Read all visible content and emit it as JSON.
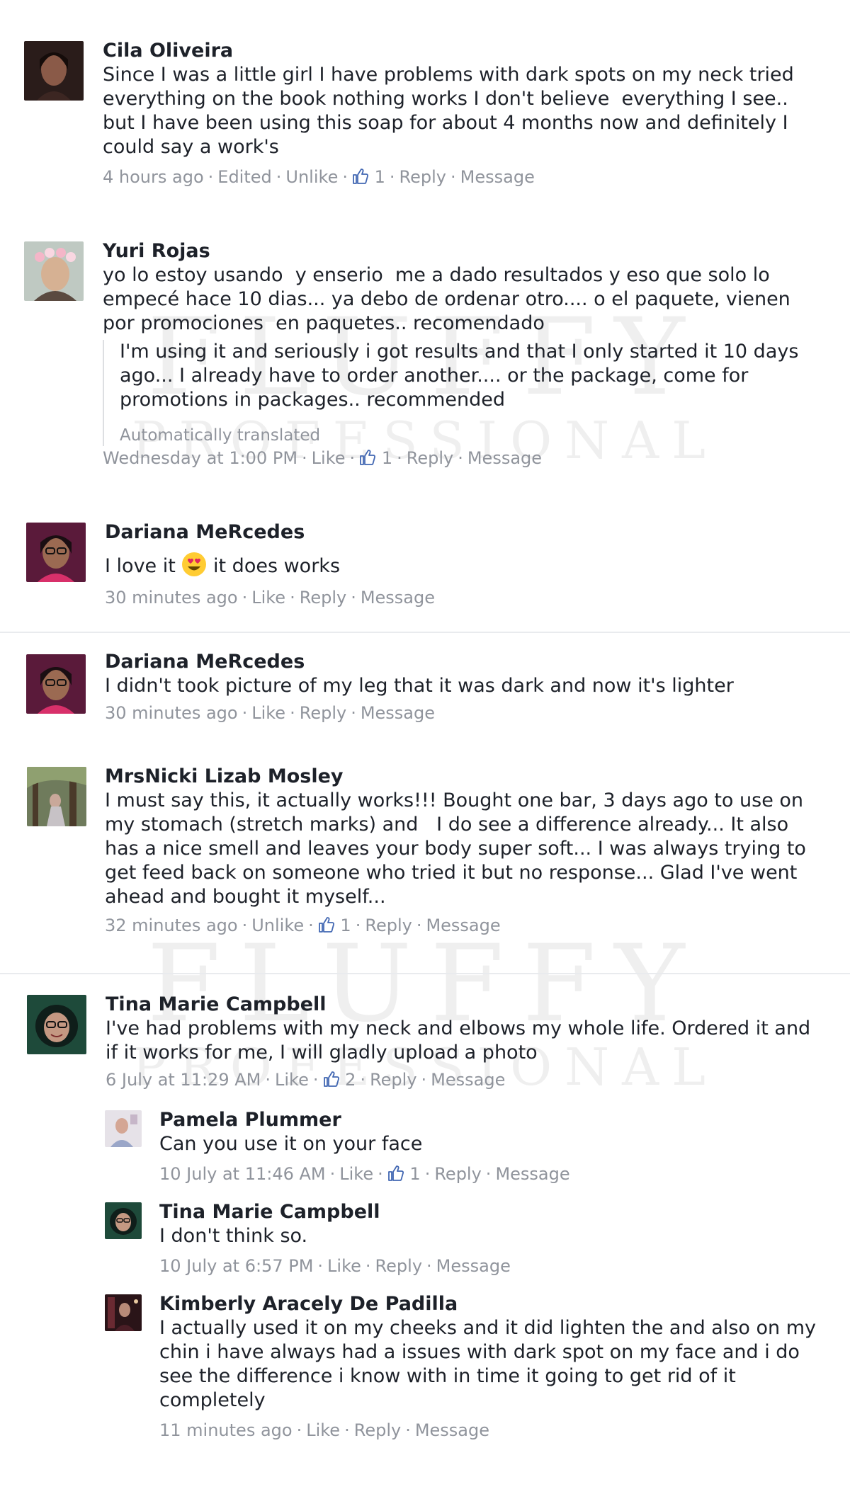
{
  "watermark": {
    "line1": "FLUFFY",
    "line2": "PROFESSIONAL"
  },
  "comments": [
    {
      "author": "Cila Oliveira",
      "text": "Since I was a little girl I have problems with dark spots on my neck tried everything on the book nothing works I don't believe  everything I see.. but I have been using this soap for about 4 months now and definitely I could say a work's",
      "time": "4 hours ago",
      "edited": "Edited",
      "like_label": "Unlike",
      "likes": "1",
      "reply_label": "Reply",
      "message_label": "Message"
    },
    {
      "author": "Yuri Rojas",
      "text": "yo lo estoy usando  y enserio  me a dado resultados y eso que solo lo empecé hace 10 dias... ya debo de ordenar otro.... o el paquete, vienen por promociones  en paquetes.. recomendado",
      "translation": "I'm using it and seriously i got results and that I only started it 10 days ago... I already have to order another.... or the package, come for promotions in packages.. recommended",
      "translation_note": "Automatically translated",
      "time": "Wednesday at 1:00 PM",
      "like_label": "Like",
      "likes": "1",
      "reply_label": "Reply",
      "message_label": "Message"
    },
    {
      "author": "Dariana MeRcedes",
      "text_before": "I love it",
      "emoji": "heart-eyes-emoji",
      "text_after": "it does works",
      "time": "30 minutes ago",
      "like_label": "Like",
      "reply_label": "Reply",
      "message_label": "Message"
    },
    {
      "author": "Dariana MeRcedes",
      "text": "I didn't took picture of my leg that it was dark and now it's lighter",
      "time": "30 minutes ago",
      "like_label": "Like",
      "reply_label": "Reply",
      "message_label": "Message"
    },
    {
      "author": "MrsNicki Lizab Mosley",
      "text": "I must say this, it actually works!!! Bought one bar, 3 days ago to use on my stomach (stretch marks) and   I do see a difference already... It also has a nice smell and leaves your body super soft... I was always trying to get feed back on someone who tried it but no response... Glad I've went ahead and bought it myself...",
      "time": "32 minutes ago",
      "like_label": "Unlike",
      "likes": "1",
      "reply_label": "Reply",
      "message_label": "Message"
    },
    {
      "author": "Tina Marie Campbell",
      "text": "I've had problems with my neck and elbows my whole life. Ordered it and if it works for me, I will gladly upload a photo",
      "time": "6 July at 11:29 AM",
      "like_label": "Like",
      "likes": "2",
      "reply_label": "Reply",
      "message_label": "Message"
    }
  ],
  "replies": [
    {
      "author": "Pamela Plummer",
      "text": "Can you use it on your face",
      "time": "10 July at 11:46 AM",
      "like_label": "Like",
      "likes": "1",
      "reply_label": "Reply",
      "message_label": "Message"
    },
    {
      "author": "Tina Marie Campbell",
      "text": "I don't think so.",
      "time": "10 July at 6:57 PM",
      "like_label": "Like",
      "reply_label": "Reply",
      "message_label": "Message"
    },
    {
      "author": "Kimberly Aracely De Padilla",
      "text": "I actually used it on my cheeks and it did lighten the and also on my chin i have always had a issues with dark spot on my face and i do see the difference i know with in time it going to get rid of it completely",
      "time": "11 minutes ago",
      "like_label": "Like",
      "reply_label": "Reply",
      "message_label": "Message"
    }
  ],
  "colors": {
    "meta_gray": "#90949c",
    "name_dark": "#1d2129",
    "thumb_blue": "#4267b2",
    "divider": "#e9ebee"
  }
}
